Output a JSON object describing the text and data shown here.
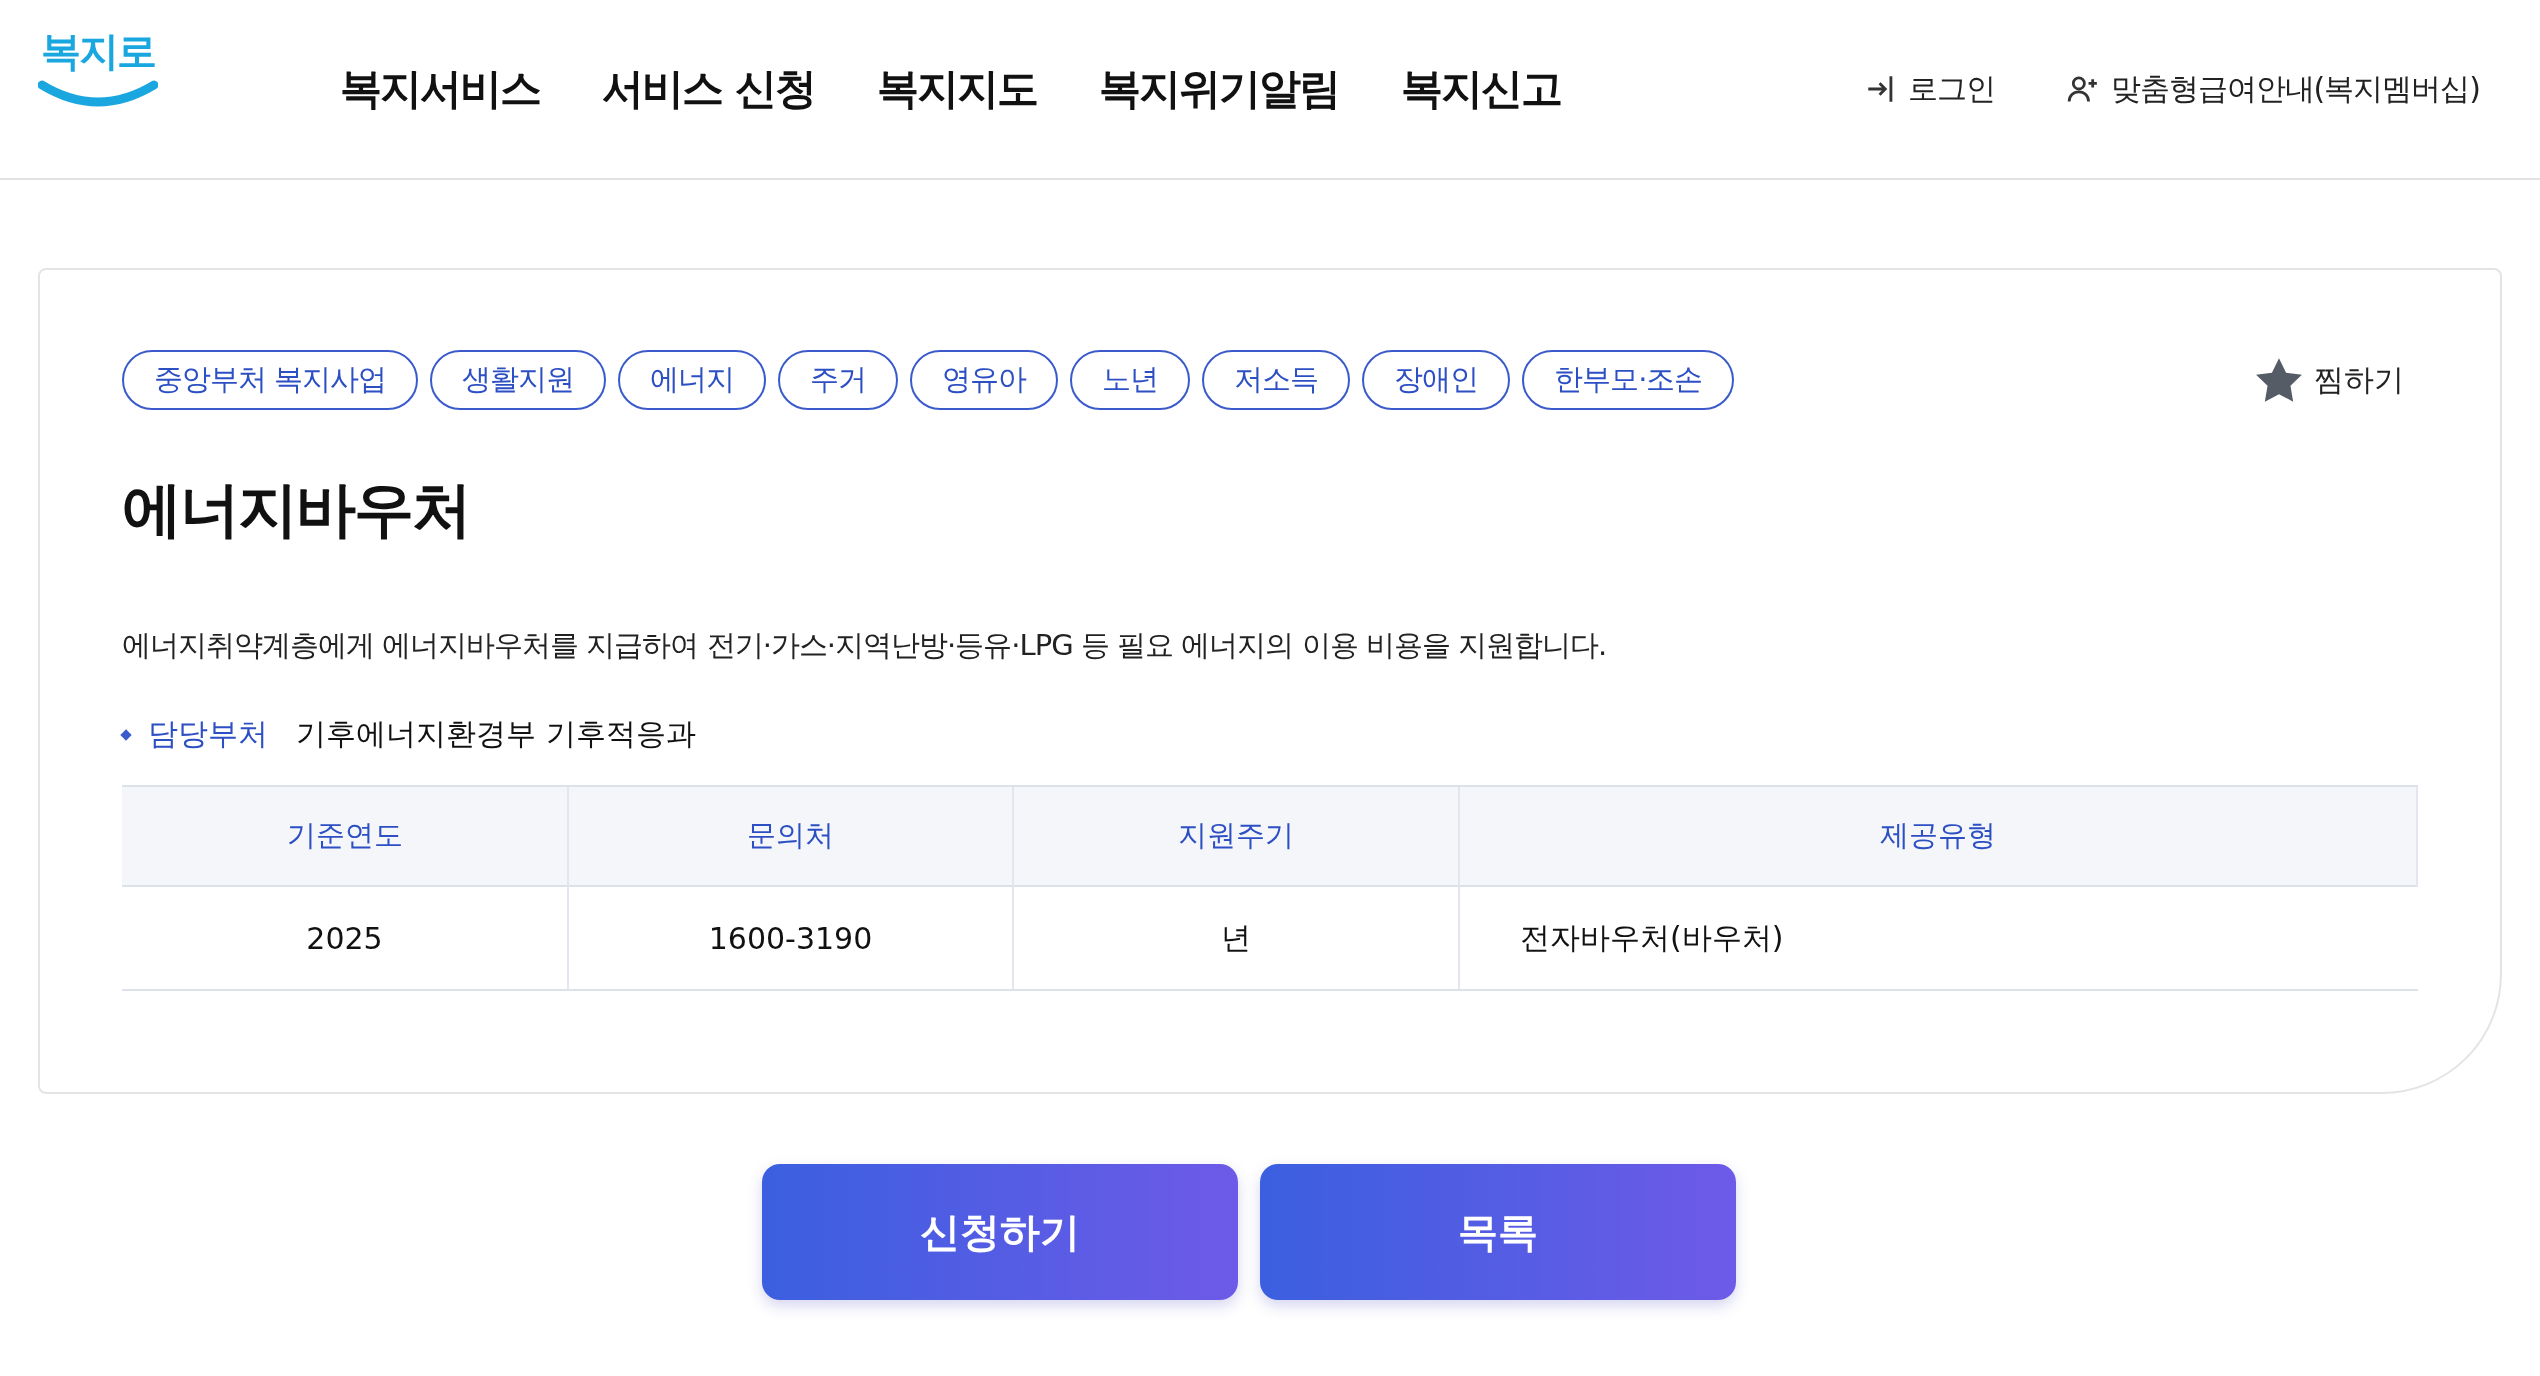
{
  "header": {
    "logo": "복지로",
    "nav": [
      "복지서비스",
      "서비스 신청",
      "복지지도",
      "복지위기알림",
      "복지신고"
    ],
    "utility": [
      {
        "kind": "login",
        "label": "로그인"
      },
      {
        "kind": "member",
        "label": "맞춤형급여안내(복지멤버십)"
      }
    ]
  },
  "service": {
    "tags": [
      "중앙부처 복지사업",
      "생활지원",
      "에너지",
      "주거",
      "영유아",
      "노년",
      "저소득",
      "장애인",
      "한부모·조손"
    ],
    "bookmark": {
      "label": "찜하기",
      "selected": false
    },
    "title": "에너지바우처",
    "description": "에너지취약계층에게 에너지바우처를 지급하여 전기·가스·지역난방·등유·LPG 등 필요 에너지의 이용 비용을 지원합니다.",
    "department": {
      "label": "담당부처",
      "value": "기후에너지환경부 기후적응과"
    },
    "table": {
      "columns": [
        "기준연도",
        "문의처",
        "지원주기",
        "제공유형"
      ],
      "rows": [
        [
          "2025",
          "1600-3190",
          "년",
          "전자바우처(바우처)"
        ]
      ]
    }
  },
  "buttons": [
    "신청하기",
    "목록"
  ]
}
